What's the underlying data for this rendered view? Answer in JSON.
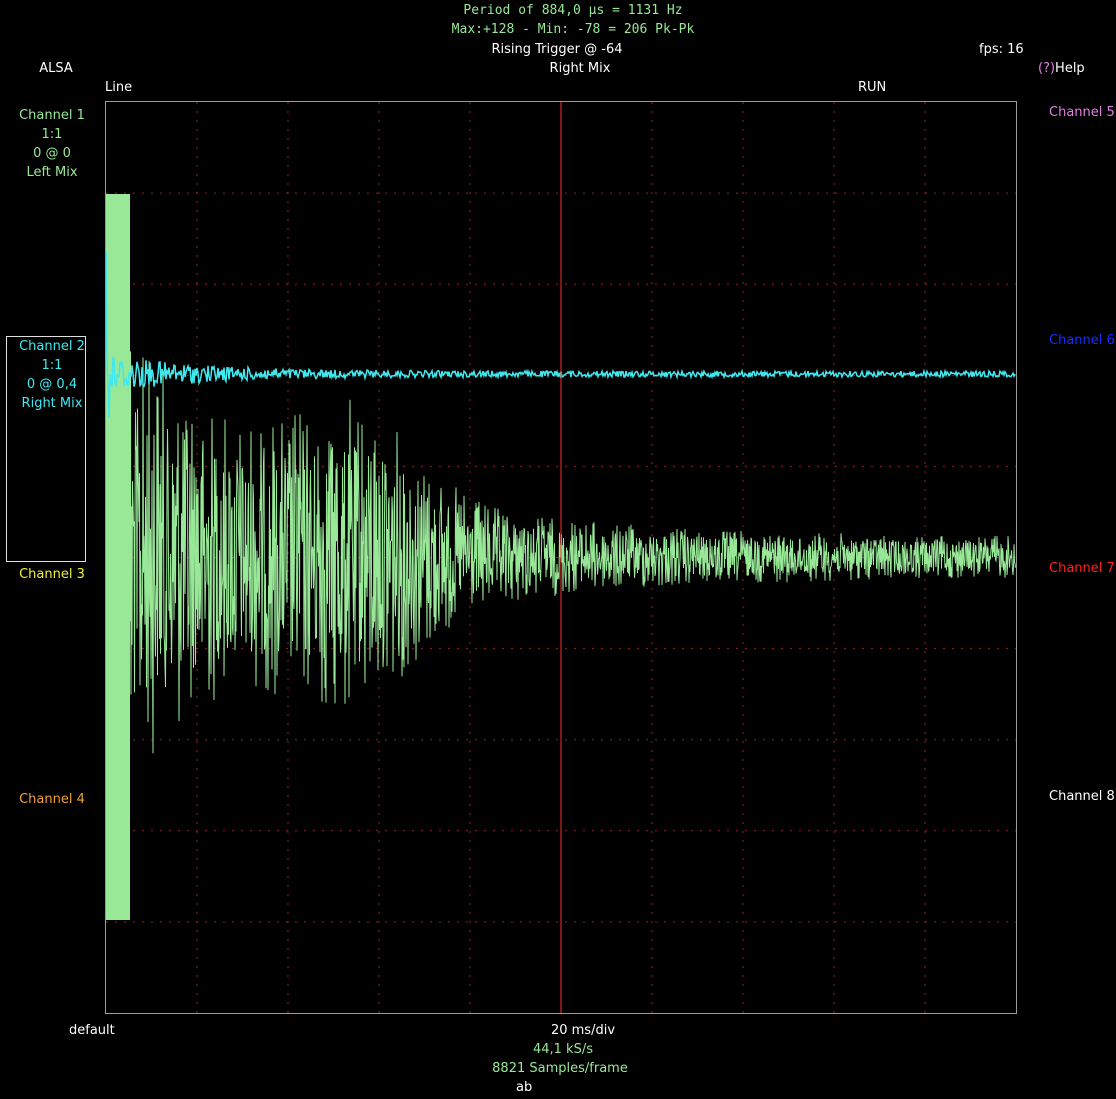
{
  "status": {
    "period": "Period of 884,0 µs =  1131 Hz",
    "minmax": "Max:+128 - Min: -78 = 206 Pk-Pk",
    "trigger": "Rising Trigger @ -64",
    "fps": "fps: 16",
    "source": "ALSA",
    "trigger_channel": "Right Mix",
    "help_key": "(?)",
    "help_label": "Help",
    "input": "Line",
    "run_state": "RUN"
  },
  "left_channels": [
    {
      "name": "Channel 1",
      "scale": "1:1",
      "offset": "0 @ 0",
      "source": "Left Mix",
      "color": "#98e898"
    },
    {
      "name": "Channel 2",
      "scale": "1:1",
      "offset": "0 @ 0,4",
      "source": "Right Mix",
      "color": "#40e8f0"
    },
    {
      "name": "Channel 3",
      "color": "#f0f040"
    },
    {
      "name": "Channel 4",
      "color": "#f0a030"
    }
  ],
  "right_channels": [
    {
      "name": "Channel 5",
      "color": "#e080e0"
    },
    {
      "name": "Channel 6",
      "color": "#1a2cff"
    },
    {
      "name": "Channel 7",
      "color": "#ff2020"
    },
    {
      "name": "Channel 8",
      "color": "#ffffff"
    }
  ],
  "bottom": {
    "device": "default",
    "timebase": "20 ms/div",
    "sample_rate": "44,1 kS/s",
    "samples": "8821 Samples/frame",
    "mode": "ab"
  },
  "colors": {
    "grid": "#9a2020",
    "trigger_line": "#ff2a2a",
    "border": "#9a9a9a"
  }
}
